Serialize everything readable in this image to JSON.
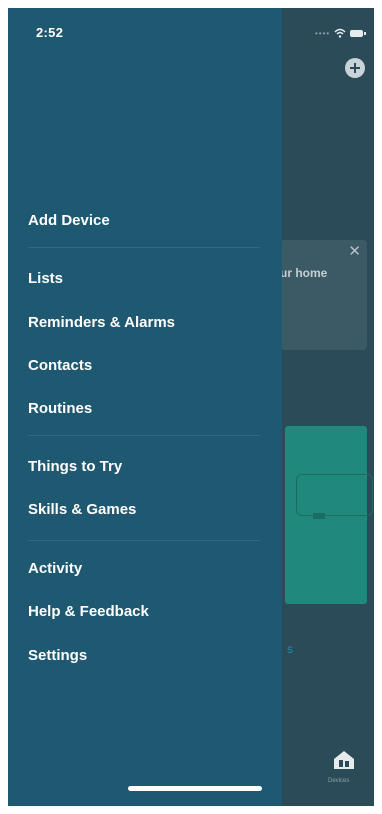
{
  "status_bar": {
    "time": "2:52"
  },
  "drawer": {
    "items": [
      {
        "label": "Add Device"
      },
      {
        "label": "Lists"
      },
      {
        "label": "Reminders & Alarms"
      },
      {
        "label": "Contacts"
      },
      {
        "label": "Routines"
      },
      {
        "label": "Things to Try"
      },
      {
        "label": "Skills & Games"
      },
      {
        "label": "Activity"
      },
      {
        "label": "Help & Feedback"
      },
      {
        "label": "Settings"
      }
    ]
  },
  "background": {
    "card_text": "ur home",
    "devices_label": "Devices",
    "link_text": "s"
  },
  "colors": {
    "drawer_bg": "#1e5871",
    "backdrop": "#2a4b57",
    "tile": "#21887e"
  }
}
